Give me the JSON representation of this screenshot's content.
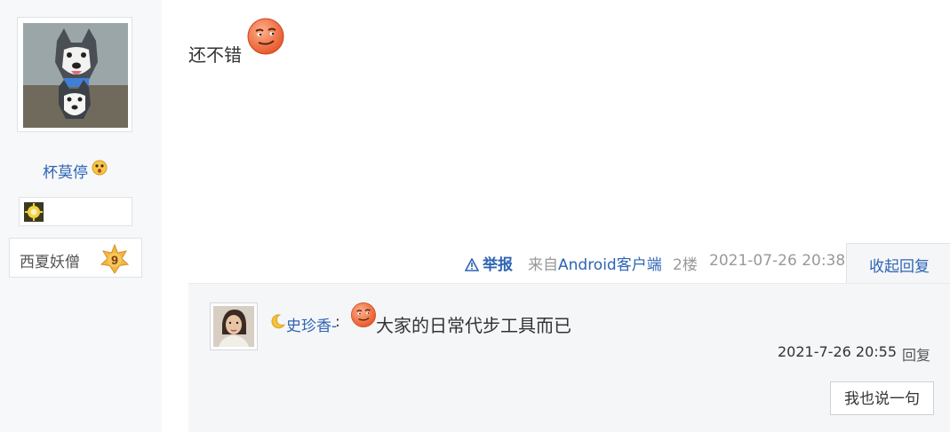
{
  "author": {
    "username": "杯莫停",
    "rank_name": "西夏妖僧",
    "rank_level": "9"
  },
  "post": {
    "text": "还不错",
    "report_label": "举报",
    "source_prefix": "来自",
    "source_app": "Android客户端",
    "floor": "2楼",
    "timestamp": "2021-07-26 20:38",
    "collapse_label": "收起回复"
  },
  "reply": {
    "username": "史珍香-",
    "colon": ":",
    "text": "大家的日常代步工具而已",
    "timestamp": "2021-7-26 20:55",
    "reply_label": "回复",
    "say_button_label": "我也说一句"
  },
  "colors": {
    "link": "#2d64b3",
    "muted": "#999999",
    "sidebar_bg": "#f7f8fa",
    "reply_bg": "#f5f6f8"
  }
}
